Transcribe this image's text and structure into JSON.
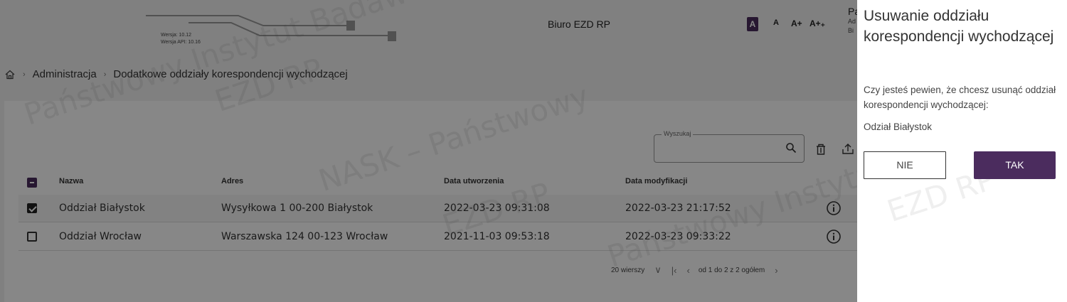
{
  "app": {
    "title": "Biuro EZD RP",
    "version": "Wersja: 10.12",
    "api_version": "Wersja API: 10.16",
    "font_controls": [
      "A",
      "A",
      "A+",
      "A+₊"
    ],
    "user_initial": "Pa",
    "user_line1": "Ad",
    "user_line2": "Bi"
  },
  "breadcrumb": {
    "items": [
      "Administracja",
      "Dodatkowe oddziały korespondencji wychodzącej"
    ]
  },
  "search": {
    "label": "Wyszukaj",
    "value": ""
  },
  "table": {
    "headers": [
      "Nazwa",
      "Adres",
      "Data utworzenia",
      "Data modyfikacji"
    ],
    "rows": [
      {
        "checked": true,
        "name": "Oddział Białystok",
        "address": "Wysyłkowa 1 00-200 Białystok",
        "created": "2022-03-23 09:31:08",
        "modified": "2022-03-23 21:17:52"
      },
      {
        "checked": false,
        "name": "Oddział Wrocław",
        "address": "Warszawska 124 00-123 Wrocław",
        "created": "2021-11-03 09:53:18",
        "modified": "2022-03-23 09:33:22"
      }
    ]
  },
  "pager": {
    "rows_per_page": "20 wierszy",
    "range": "od 1 do 2 z 2 ogółem"
  },
  "watermark": {
    "lines": [
      "Państwowy Instytut Badawczy",
      "NASK – Państwowy",
      "EZD RP"
    ]
  },
  "dialog": {
    "title": "Usuwanie oddziału korespondencji wychodzącej",
    "message": "Czy jesteś pewien, że chcesz usunąć oddział korespondencji wychodzącej:",
    "item": "Odział Białystok",
    "no_label": "NIE",
    "yes_label": "TAK"
  },
  "colors": {
    "accent": "#4b2c5e",
    "overlay": "rgba(0,0,0,0.47)"
  }
}
